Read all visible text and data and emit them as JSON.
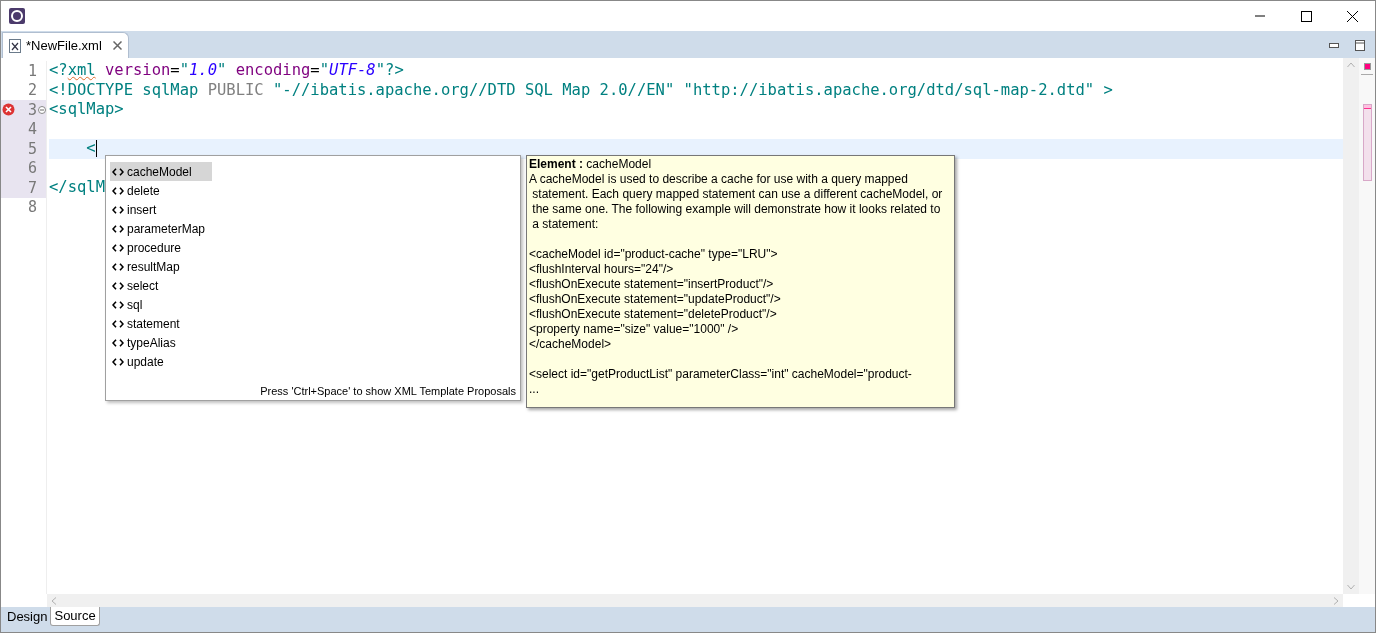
{
  "editor_tab": {
    "label": "*NewFile.xml",
    "selected": true
  },
  "code_lines": [
    {
      "number": "1",
      "error": false,
      "current": false,
      "tokens": [
        {
          "text": "<?",
          "kind": "tag"
        },
        {
          "text": "xml",
          "kind": "tag_warn"
        },
        {
          "text": " version",
          "kind": "attr"
        },
        {
          "text": "=",
          "kind": "plain"
        },
        {
          "text": "\"",
          "kind": "tag"
        },
        {
          "text": "1.0",
          "kind": "value"
        },
        {
          "text": "\"",
          "kind": "tag"
        },
        {
          "text": " encoding",
          "kind": "attr"
        },
        {
          "text": "=",
          "kind": "plain"
        },
        {
          "text": "\"",
          "kind": "tag"
        },
        {
          "text": "UTF-8",
          "kind": "value"
        },
        {
          "text": "\"?>",
          "kind": "tag"
        }
      ]
    },
    {
      "number": "2",
      "error": false,
      "current": false,
      "tokens": [
        {
          "text": "<!DOCTYPE sqlMap ",
          "kind": "tag"
        },
        {
          "text": "PUBLIC",
          "kind": "keyword"
        },
        {
          "text": " \"-//ibatis.apache.org//DTD SQL Map 2.0//EN\" \"http://ibatis.apache.org/dtd/sql-map-2.dtd\" >",
          "kind": "tag"
        }
      ]
    },
    {
      "number": "3",
      "error": true,
      "current": false,
      "tokens": [
        {
          "text": "<sqlMap>",
          "kind": "tag"
        }
      ]
    },
    {
      "number": "4",
      "error": false,
      "current": false
    },
    {
      "number": "5",
      "error": false,
      "current": true,
      "tokens": [
        {
          "text": "    <",
          "kind": "tag"
        }
      ]
    },
    {
      "number": "6",
      "error": false,
      "current": false
    },
    {
      "number": "7",
      "error": false,
      "current": false,
      "tokens": [
        {
          "text": "</sqlM",
          "kind": "tag"
        }
      ]
    },
    {
      "number": "8",
      "error": false,
      "current": false
    }
  ],
  "completion": {
    "items": [
      {
        "label": "cacheModel",
        "selected": true
      },
      {
        "label": "delete",
        "selected": false
      },
      {
        "label": "insert",
        "selected": false
      },
      {
        "label": "parameterMap",
        "selected": false
      },
      {
        "label": "procedure",
        "selected": false
      },
      {
        "label": "resultMap",
        "selected": false
      },
      {
        "label": "select",
        "selected": false
      },
      {
        "label": "sql",
        "selected": false
      },
      {
        "label": "statement",
        "selected": false
      },
      {
        "label": "typeAlias",
        "selected": false
      },
      {
        "label": "update",
        "selected": false
      }
    ],
    "hint": "Press 'Ctrl+Space' to show XML Template Proposals"
  },
  "info": {
    "title_label": "Element :",
    "title_value": "cacheModel",
    "description_lines": [
      "A cacheModel is used to describe a cache for use with a query mapped",
      " statement. Each query mapped statement can use a different cacheModel, or",
      " the same one. The following example will demonstrate how it looks related to",
      " a statement:"
    ],
    "example_lines": [
      "<cacheModel id=\"product-cache\" type=\"LRU\">",
      "<flushInterval hours=\"24\"/>",
      "<flushOnExecute statement=\"insertProduct\"/>",
      "<flushOnExecute statement=\"updateProduct\"/>",
      "<flushOnExecute statement=\"deleteProduct\"/>",
      "<property name=\"size\" value=\"1000\" />",
      "</cacheModel>"
    ],
    "tail_lines": [
      "<select id=\"getProductList\" parameterClass=\"int\" cacheModel=\"product-",
      "..."
    ]
  },
  "bottom_tabs": [
    {
      "label": "Design",
      "selected": false
    },
    {
      "label": "Source",
      "selected": true
    }
  ]
}
